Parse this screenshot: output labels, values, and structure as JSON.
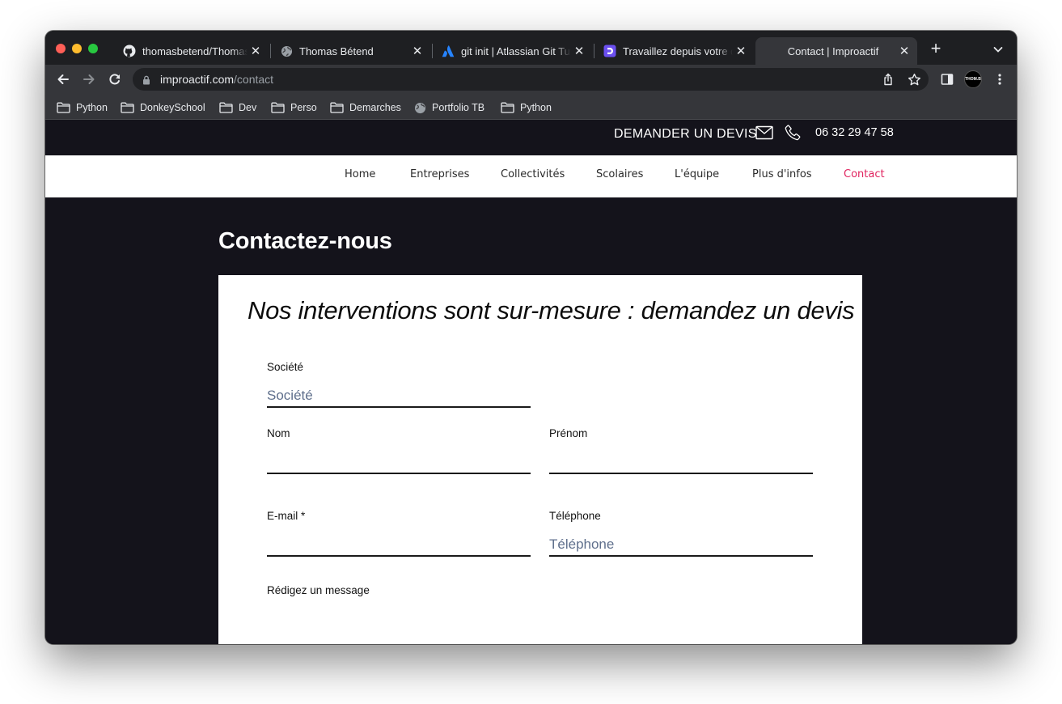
{
  "browser": {
    "tabs": [
      {
        "title": "thomasbetend/ThomasBetend",
        "icon": "github-icon"
      },
      {
        "title": "Thomas Bétend",
        "icon": "globe-icon"
      },
      {
        "title": "git init | Atlassian Git Tutorial",
        "icon": "atlassian-icon"
      },
      {
        "title": "Travaillez depuis votre domicile",
        "icon": "app-d-icon"
      },
      {
        "title": "Contact | Improactif",
        "icon": "none",
        "active": true
      }
    ],
    "close_glyph": "✕",
    "newtab_glyph": "+",
    "url_domain": "improactif.com",
    "url_path": "/contact",
    "profile_label": "THOM.B",
    "bookmarks": [
      {
        "label": "Python",
        "icon": "folder-icon"
      },
      {
        "label": "DonkeySchool",
        "icon": "folder-icon"
      },
      {
        "label": "Dev",
        "icon": "folder-icon"
      },
      {
        "label": "Perso",
        "icon": "folder-icon"
      },
      {
        "label": "Demarches",
        "icon": "folder-icon"
      },
      {
        "label": "Portfolio TB",
        "icon": "globe-icon"
      },
      {
        "label": "Python",
        "icon": "folder-icon"
      }
    ]
  },
  "site": {
    "topbar": {
      "devis_label": "DEMANDER UN DEVIS",
      "phone": "06 32 29 47 58"
    },
    "nav": [
      "Home",
      "Entreprises",
      "Collectivités",
      "Scolaires",
      "L'équipe",
      "Plus d'infos",
      "Contact"
    ],
    "active_nav": "Contact",
    "heading": "Contactez-nous",
    "form": {
      "title": "Nos interventions sont sur-mesure : demandez un devis",
      "societe": {
        "label": "Société",
        "placeholder": "Société"
      },
      "nom": {
        "label": "Nom",
        "placeholder": ""
      },
      "prenom": {
        "label": "Prénom",
        "placeholder": ""
      },
      "email": {
        "label": "E-mail *",
        "placeholder": ""
      },
      "telephone": {
        "label": "Téléphone",
        "placeholder": "Téléphone"
      },
      "message": {
        "label": "Rédigez un message"
      }
    }
  },
  "colors": {
    "page_bg": "#14131b",
    "nav_active": "#e0235f",
    "placeholder": "#5f6f8c"
  }
}
